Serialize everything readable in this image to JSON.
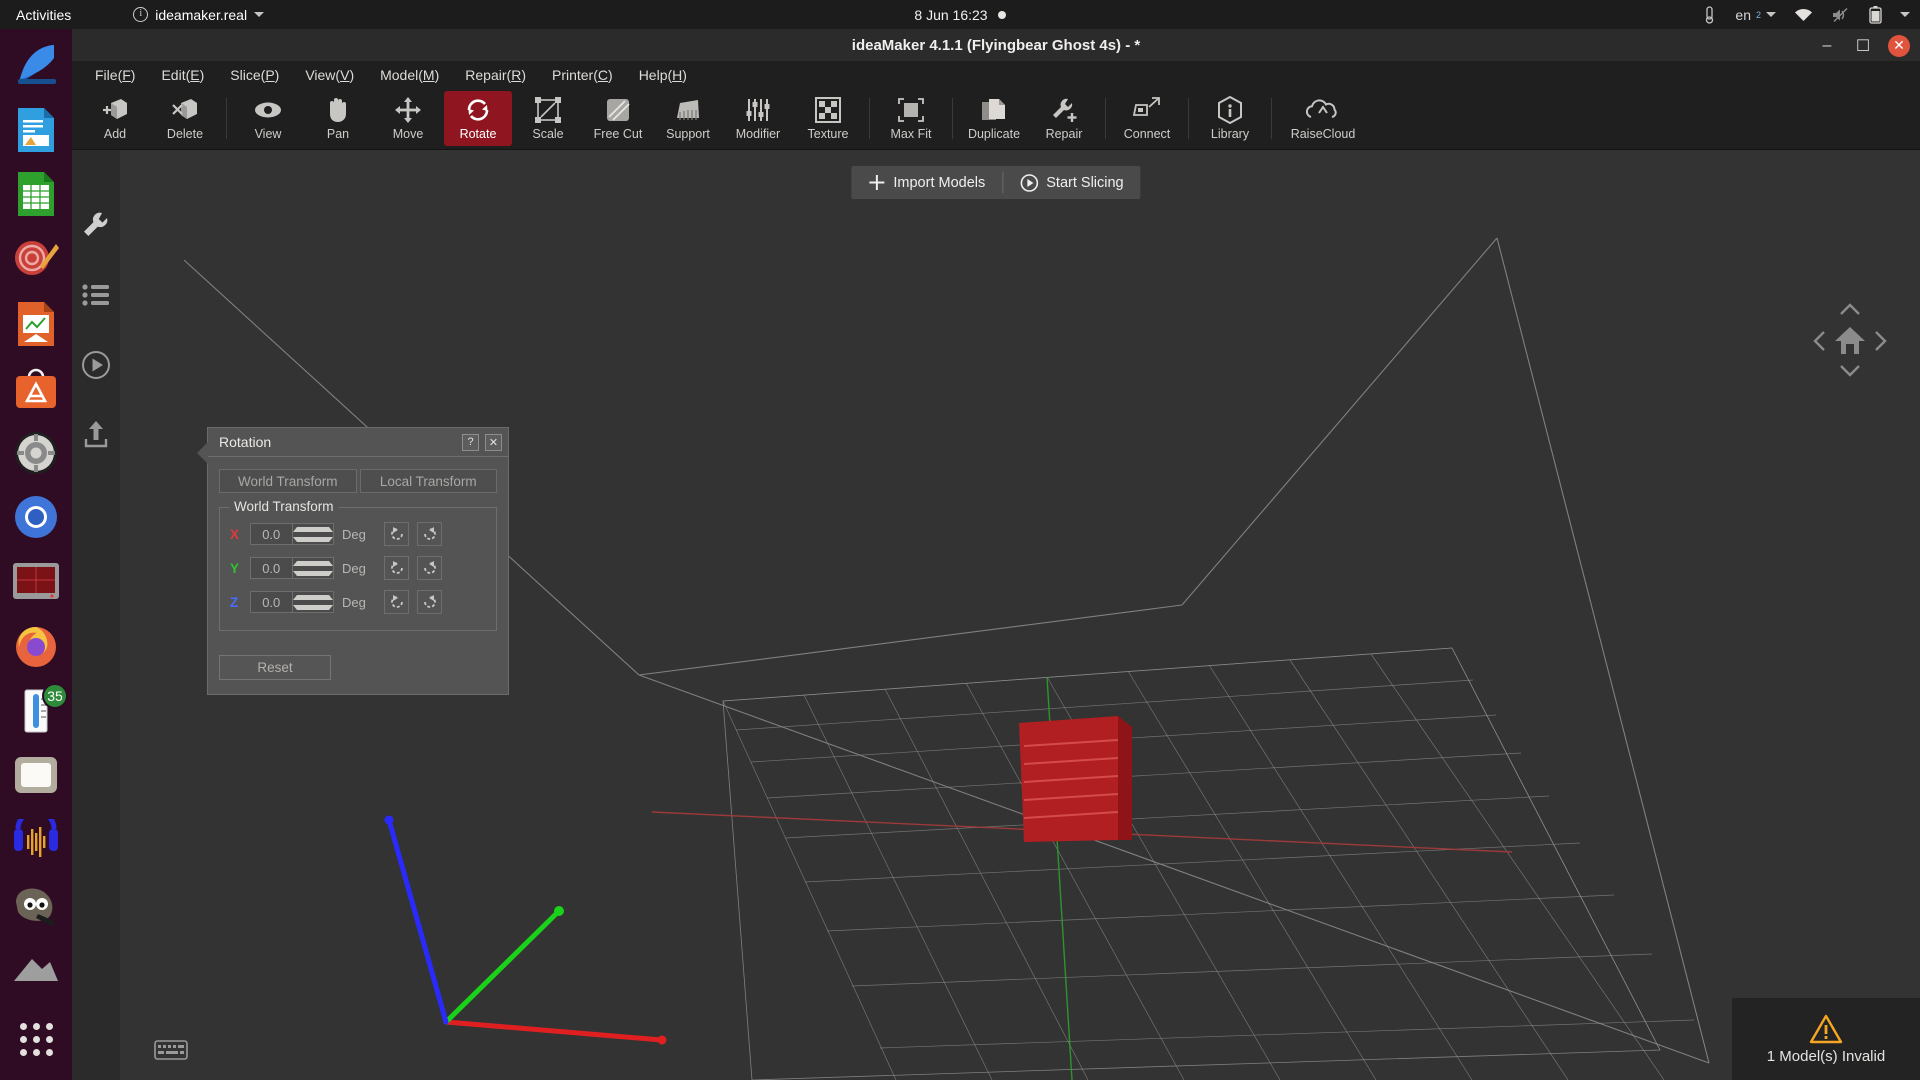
{
  "topbar": {
    "activities": "Activities",
    "app_menu": "ideamaker.real",
    "app_info_icon": "info-icon",
    "clock": "8 Jun  16:23",
    "recording_dot": "record-dot-icon",
    "tray": {
      "thermometer_icon": "thermometer-icon",
      "keyboard_layout": "en",
      "keyboard_layout_sub": "2",
      "wifi_icon": "wifi-icon",
      "volume_icon": "volume-muted-icon",
      "battery_icon": "battery-icon",
      "menu_caret_icon": "chevron-down-icon"
    }
  },
  "dock": {
    "items": [
      {
        "name": "wireshark",
        "icon": "shark-fin-icon"
      },
      {
        "name": "libreoffice-writer",
        "icon": "document-icon"
      },
      {
        "name": "libreoffice-calc",
        "icon": "spreadsheet-icon"
      },
      {
        "name": "mail-seal",
        "icon": "at-sign-seal-icon"
      },
      {
        "name": "libreoffice-impress",
        "icon": "presentation-icon"
      },
      {
        "name": "ubuntu-software",
        "icon": "software-bag-icon"
      },
      {
        "name": "system-settings",
        "icon": "gear-icon"
      },
      {
        "name": "chromium",
        "icon": "chromium-icon"
      },
      {
        "name": "terminal-monitor",
        "icon": "monitor-icon"
      },
      {
        "name": "firefox",
        "icon": "firefox-icon"
      },
      {
        "name": "thermometer-app",
        "icon": "thermometer-app-icon",
        "badge": "35"
      },
      {
        "name": "files",
        "icon": "folder-icon"
      },
      {
        "name": "audacity",
        "icon": "audacity-icon"
      },
      {
        "name": "gimp",
        "icon": "gimp-icon"
      },
      {
        "name": "mountain-app",
        "icon": "mountain-icon"
      }
    ],
    "show_applications": "show-applications-icon"
  },
  "window": {
    "title": "ideaMaker 4.1.1 (Flyingbear Ghost 4s) - *",
    "controls": {
      "minimize": "–",
      "maximize": "☐",
      "close": "✕"
    }
  },
  "menubar": [
    {
      "label": "File",
      "accel": "F"
    },
    {
      "label": "Edit",
      "accel": "E"
    },
    {
      "label": "Slice",
      "accel": "P"
    },
    {
      "label": "View",
      "accel": "V"
    },
    {
      "label": "Model",
      "accel": "M"
    },
    {
      "label": "Repair",
      "accel": "R"
    },
    {
      "label": "Printer",
      "accel": "C"
    },
    {
      "label": "Help",
      "accel": "H"
    }
  ],
  "toolbar": {
    "active_tool": "Rotate",
    "active_color": "#8f1620",
    "items": [
      {
        "label": "Add",
        "icon": "add-model-icon",
        "active": false
      },
      {
        "label": "Delete",
        "icon": "delete-model-icon",
        "active": false
      },
      {
        "sep": true
      },
      {
        "label": "View",
        "icon": "eye-icon",
        "active": false
      },
      {
        "label": "Pan",
        "icon": "hand-icon",
        "active": false
      },
      {
        "label": "Move",
        "icon": "move-arrows-icon",
        "active": false
      },
      {
        "label": "Rotate",
        "icon": "rotate-icon",
        "active": true
      },
      {
        "label": "Scale",
        "icon": "scale-icon",
        "active": false
      },
      {
        "label": "Free Cut",
        "icon": "free-cut-icon",
        "active": false
      },
      {
        "label": "Support",
        "icon": "support-icon",
        "active": false
      },
      {
        "label": "Modifier",
        "icon": "sliders-icon",
        "active": false
      },
      {
        "label": "Texture",
        "icon": "checkerboard-icon",
        "active": false
      },
      {
        "sep": true
      },
      {
        "label": "Max Fit",
        "icon": "max-fit-icon",
        "active": false
      },
      {
        "sep": true
      },
      {
        "label": "Duplicate",
        "icon": "duplicate-icon",
        "active": false
      },
      {
        "label": "Repair",
        "icon": "wrench-plus-icon",
        "active": false
      },
      {
        "sep": true
      },
      {
        "label": "Connect",
        "icon": "connect-printer-icon",
        "active": false
      },
      {
        "sep": true
      },
      {
        "label": "Library",
        "icon": "library-info-icon",
        "active": false
      },
      {
        "sep": true
      },
      {
        "label": "RaiseCloud",
        "icon": "cloud-icon",
        "active": false
      }
    ]
  },
  "side_rail": [
    {
      "name": "tools",
      "icon": "wrench-icon",
      "active": true
    },
    {
      "name": "list",
      "icon": "list-icon",
      "active": false
    },
    {
      "name": "preview",
      "icon": "play-circle-icon",
      "active": false
    },
    {
      "name": "export",
      "icon": "upload-icon",
      "active": false
    }
  ],
  "top_actions": {
    "import_label": "Import Models",
    "import_icon": "plus-icon",
    "slice_label": "Start Slicing",
    "slice_icon": "play-circle-icon"
  },
  "nav_widget": {
    "home_icon": "home-icon",
    "up_icon": "chevron-up-icon",
    "down_icon": "chevron-down-icon",
    "left_icon": "chevron-left-icon",
    "right_icon": "chevron-right-icon"
  },
  "rotation_dialog": {
    "title": "Rotation",
    "help_button": "?",
    "close_button": "✕",
    "tabs": [
      {
        "label": "World Transform",
        "selected": true
      },
      {
        "label": "Local Transform",
        "selected": false
      }
    ],
    "group_label": "World Transform",
    "axes": [
      {
        "axis": "X",
        "color": "#e03a3a",
        "value": "0.0",
        "unit": "Deg",
        "ccw_icon": "rotate-ccw-icon",
        "cw_icon": "rotate-cw-icon"
      },
      {
        "axis": "Y",
        "color": "#2fc22f",
        "value": "0.0",
        "unit": "Deg",
        "ccw_icon": "rotate-ccw-icon",
        "cw_icon": "rotate-cw-icon"
      },
      {
        "axis": "Z",
        "color": "#4a6bff",
        "value": "0.0",
        "unit": "Deg",
        "ccw_icon": "rotate-ccw-icon",
        "cw_icon": "rotate-cw-icon"
      }
    ],
    "reset_label": "Reset"
  },
  "viewport": {
    "build_plate": {
      "grid": true,
      "grid_color": "#9a9a9a"
    },
    "axes": {
      "x_color": "#e02020",
      "y_color": "#19d219",
      "z_color": "#2a2aff",
      "x_guide_color": "#b03030",
      "y_guide_color": "#2f9e2f"
    },
    "model": {
      "name": "imported-model",
      "color": "#c02020",
      "state": "invalid"
    },
    "keyboard_shortcut_icon": "keyboard-icon"
  },
  "toast": {
    "icon": "warning-triangle-icon",
    "icon_color": "#f5a623",
    "message": "1 Model(s) Invalid"
  }
}
